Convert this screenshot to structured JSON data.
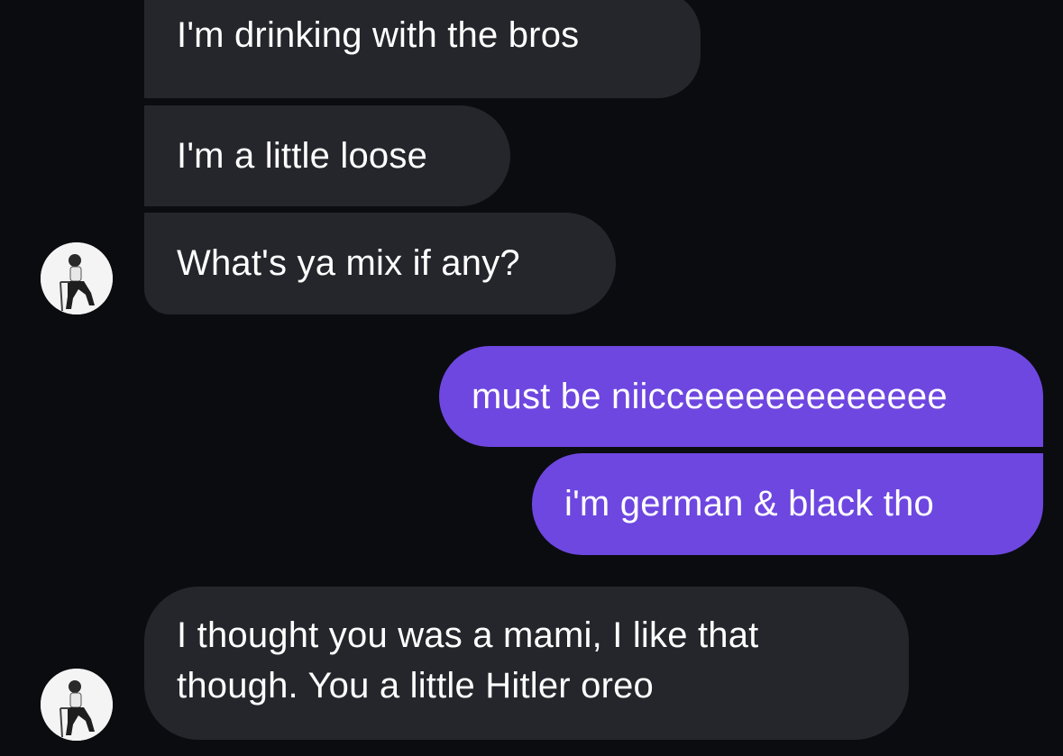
{
  "conversation": {
    "messages": [
      {
        "sender": "them",
        "text": "I'm drinking with the bros"
      },
      {
        "sender": "them",
        "text": "I'm a little loose"
      },
      {
        "sender": "them",
        "text": "What's ya mix if any?"
      },
      {
        "sender": "me",
        "text": "must be niicceeeeeeeeeeeee"
      },
      {
        "sender": "me",
        "text": "i'm german & black tho"
      },
      {
        "sender": "them",
        "lines": [
          "I thought you was a mami, I like that",
          "though. You a little Hitler oreo"
        ]
      }
    ]
  },
  "avatar": {
    "icon": "contact-avatar-icon"
  },
  "colors": {
    "background": "#0b0c10",
    "incoming_bubble": "#25262b",
    "outgoing_bubble": "#6e47e0",
    "text": "#ffffff"
  }
}
